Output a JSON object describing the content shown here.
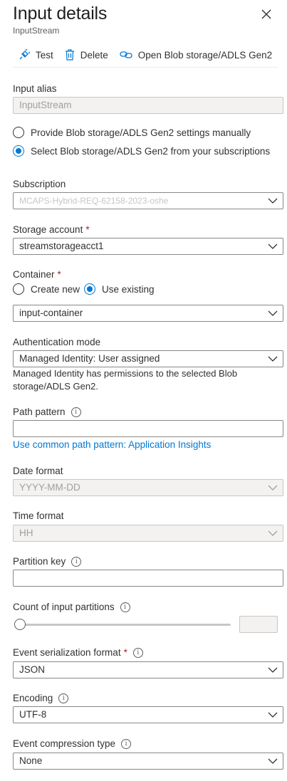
{
  "header": {
    "title": "Input details",
    "subtitle": "InputStream"
  },
  "toolbar": {
    "test_label": "Test",
    "delete_label": "Delete",
    "open_label": "Open Blob storage/ADLS Gen2"
  },
  "input_alias": {
    "label": "Input alias",
    "value": "InputStream"
  },
  "source_options": {
    "manual_label": "Provide Blob storage/ADLS Gen2 settings manually",
    "select_label": "Select Blob storage/ADLS Gen2 from your subscriptions",
    "selected": "select"
  },
  "subscription": {
    "label": "Subscription",
    "value": "MCAPS-Hybrid-REQ-62158-2023-oshe"
  },
  "storage_account": {
    "label": "Storage account",
    "required_mark": "*",
    "value": "streamstorageacct1"
  },
  "container": {
    "label": "Container",
    "required_mark": "*",
    "create_new_label": "Create new",
    "use_existing_label": "Use existing",
    "selected": "use_existing",
    "value": "input-container"
  },
  "auth_mode": {
    "label": "Authentication mode",
    "value": "Managed Identity: User assigned",
    "note": "Managed Identity has permissions to the selected Blob storage/ADLS Gen2."
  },
  "path_pattern": {
    "label": "Path pattern",
    "value": "",
    "link": "Use common path pattern: Application Insights"
  },
  "date_format": {
    "label": "Date format",
    "value": "YYYY-MM-DD"
  },
  "time_format": {
    "label": "Time format",
    "value": "HH"
  },
  "partition_key": {
    "label": "Partition key",
    "value": ""
  },
  "input_partitions": {
    "label": "Count of input partitions",
    "value": ""
  },
  "serialization": {
    "label": "Event serialization format",
    "required_mark": "*",
    "value": "JSON"
  },
  "encoding": {
    "label": "Encoding",
    "value": "UTF-8"
  },
  "compression": {
    "label": "Event compression type",
    "value": "None"
  },
  "colors": {
    "accent": "#0078d4",
    "required": "#a4262c",
    "border": "#8a8886",
    "disabled_bg": "#f3f2f1"
  }
}
